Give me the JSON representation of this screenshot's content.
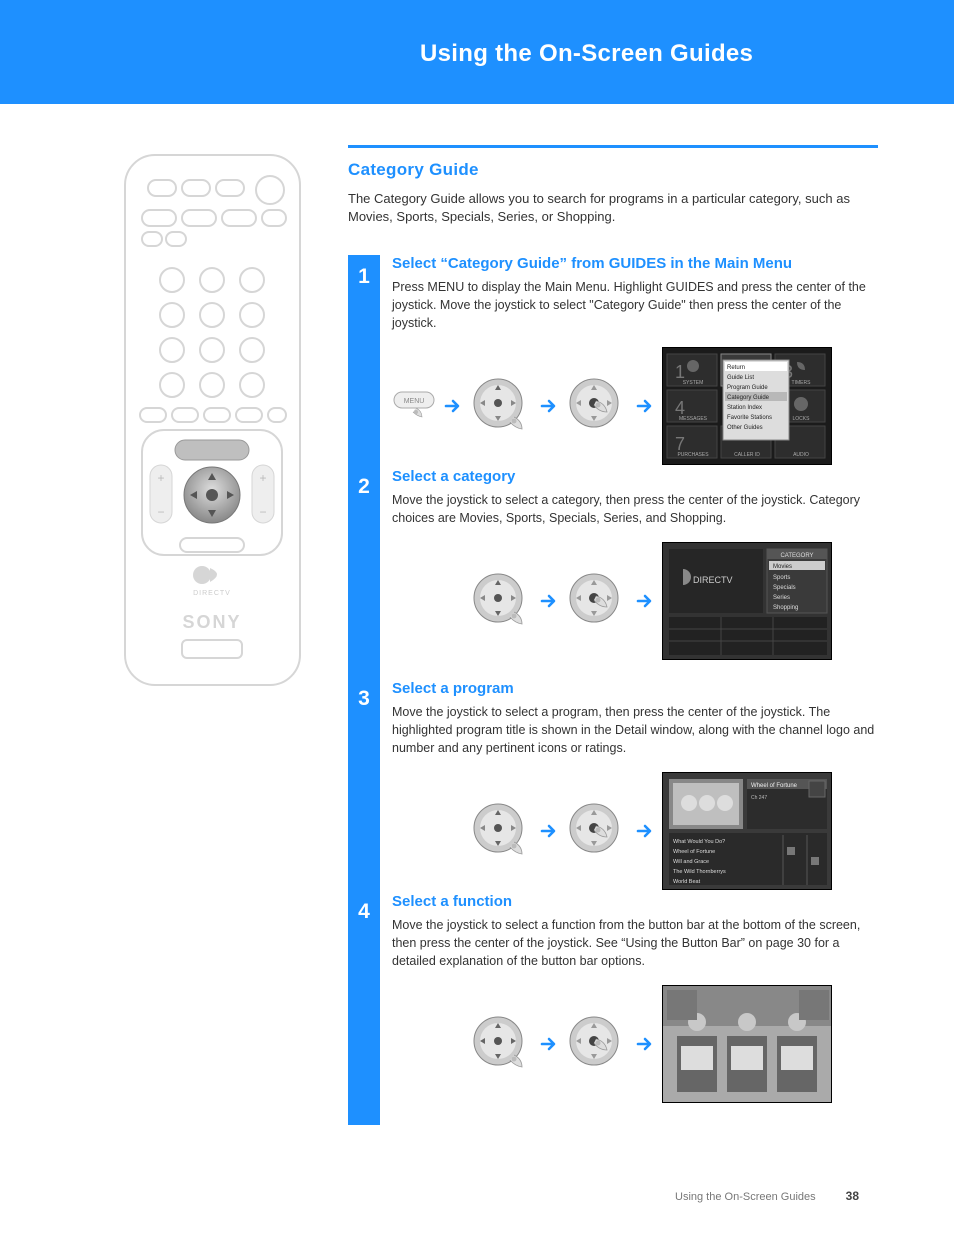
{
  "banner": {
    "title": "Using the On-Screen Guides"
  },
  "subtitle": "Category Guide",
  "intro": "The Category Guide allows you to search for programs in a particular category, such as Movies, Sports, Specials, Series, or Shopping.",
  "steps": [
    {
      "num": "1",
      "hd": "Select “Category Guide” from GUIDES in the Main Menu",
      "txt": "Press MENU to display the Main Menu. Highlight GUIDES and press the center of the joystick. Move the joystick to select \"Category Guide\" then press the center of the joystick.",
      "screenshot": "menu"
    },
    {
      "num": "2",
      "hd": "Select a category",
      "txt": "Move the joystick to select a category, then press the center of the joystick. Category choices are Movies, Sports, Specials, Series, and Shopping.",
      "screenshot": "category"
    },
    {
      "num": "3",
      "hd": "Select a program",
      "txt": "Move the joystick to select a program, then press the center of the joystick. The highlighted program title is shown in the Detail window, along with the channel logo and number and any pertinent icons or ratings.",
      "screenshot": "program"
    },
    {
      "num": "4",
      "hd": "Select a function",
      "txt": "Move the joystick to select a function from the button bar at the bottom of the screen, then press the center of the joystick. See “Using the Button Bar” on page 30 for a detailed explanation of the button bar options.",
      "screenshot": "function"
    }
  ],
  "footer": {
    "section": "Using the On-Screen Guides",
    "page": "38"
  },
  "category_list": [
    "Movies",
    "Sports",
    "Specials",
    "Series",
    "Shopping"
  ],
  "menu_items": [
    "Return",
    "Guide List",
    "Program Guide",
    "Category Guide",
    "Station Index",
    "Favorite Stations",
    "Other Guides"
  ],
  "icons": {
    "arrow": "arrow-right",
    "joystick": "joystick-button",
    "menu_button": "menu-button"
  }
}
